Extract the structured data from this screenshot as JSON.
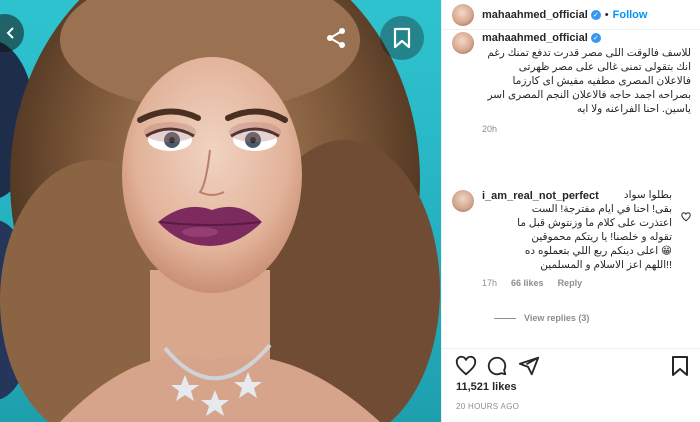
{
  "header": {
    "username": "mahaahmed_official",
    "separator": "•",
    "follow_label": "Follow"
  },
  "caption": {
    "username": "mahaahmed_official",
    "text": "للاسف فالوقت اللى مصر قدرت تدفع تمنك رغم انك بتقولى تمنى غالى على مصر ظهرتى فالاعلان المصرى مطفيه مفيش اى كارزما بصراحه اجمد حاجه فالاعلان النجم المصرى اسر ياسين. احنا الفراعنه ولا ايه",
    "time": "20h"
  },
  "comment": {
    "username": "i_am_real_not_perfect",
    "text_lines": [
      "بطلوا سواد",
      "بقى! احنا في ايام مفترجة! الست",
      "اعتذرت على كلام ما وزنتوش قبل ما",
      "تقوله و خلصنا! يا ريتكم محموقين",
      "😁 اعلى دينكم ربع اللي بتعملوه ده",
      "!!اللهم اعز الاسلام و المسلمين"
    ],
    "time": "17h",
    "likes": "66 likes",
    "reply_label": "Reply",
    "view_replies": "View replies (3)"
  },
  "stats": {
    "likes": "11,521 likes",
    "posted": "20 HOURS AGO"
  },
  "icons": [
    "back-icon",
    "share-icon",
    "bookmark-icon",
    "heart-icon",
    "comment-icon",
    "send-icon",
    "save-icon",
    "verified-icon"
  ],
  "colors": {
    "accent": "#0095f6",
    "verified": "#3897f0",
    "background": "#2fc3cf"
  }
}
